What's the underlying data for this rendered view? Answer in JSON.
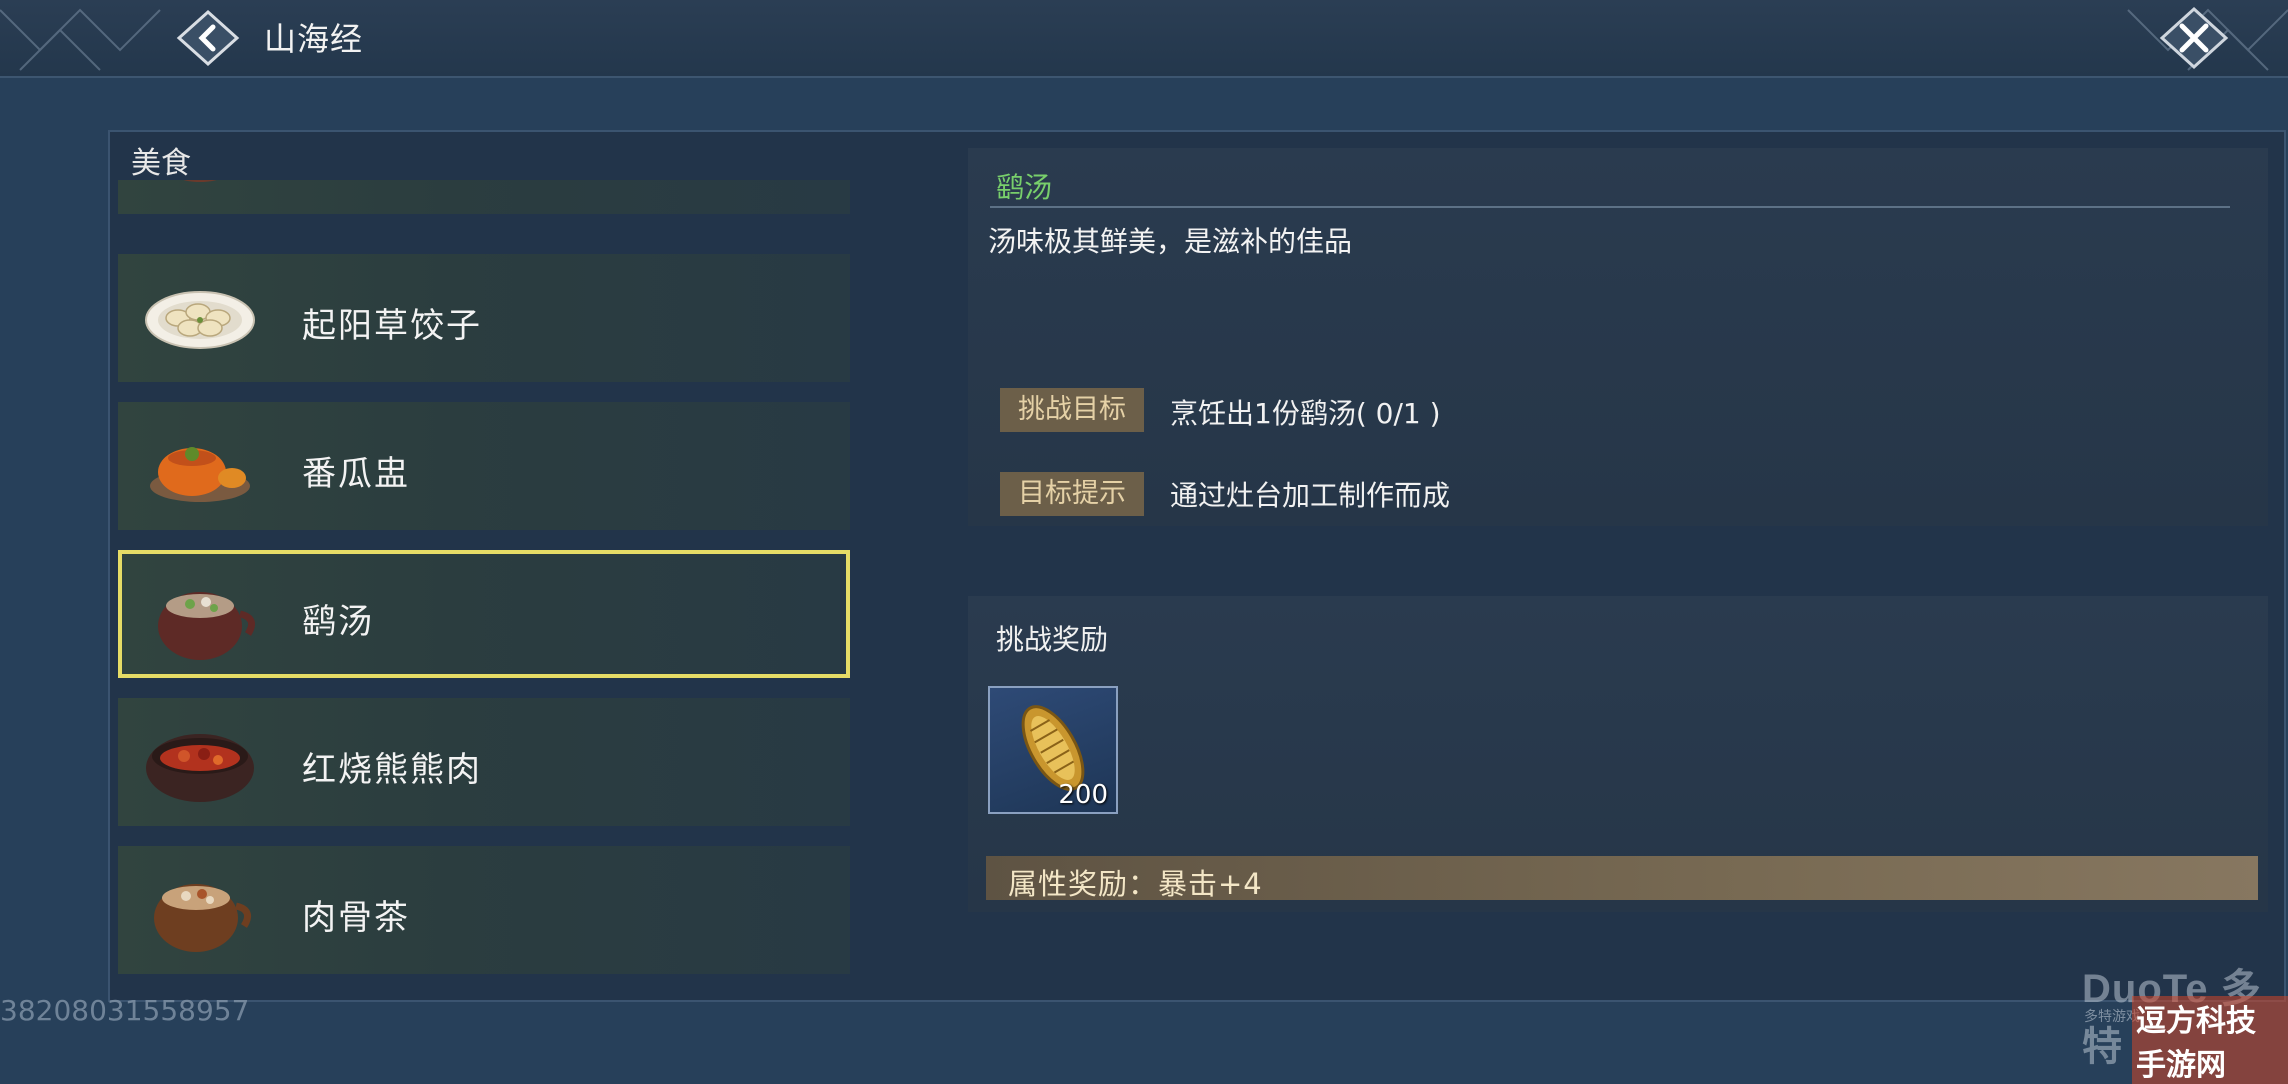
{
  "header": {
    "title": "山海经",
    "back_icon": "back-chevron-icon",
    "close_icon": "close-x-icon"
  },
  "section": {
    "label": "美食"
  },
  "foods": [
    {
      "name": "",
      "icon": "stew-bowl-icon"
    },
    {
      "name": "起阳草饺子",
      "icon": "dumplings-plate-icon"
    },
    {
      "name": "番瓜盅",
      "icon": "pumpkin-cup-icon"
    },
    {
      "name": "鹞汤",
      "icon": "soup-pot-icon",
      "selected": true
    },
    {
      "name": "红烧熊熊肉",
      "icon": "braised-meat-bowl-icon"
    },
    {
      "name": "肉骨茶",
      "icon": "bone-tea-pot-icon"
    }
  ],
  "detail": {
    "title": "鹞汤",
    "description": "汤味极其鲜美，是滋补的佳品",
    "challenge_tag": "挑战目标",
    "challenge_text": "烹饪出1份鹞汤( 0/1 )",
    "hint_tag": "目标提示",
    "hint_text": "通过灶台加工制作而成"
  },
  "reward": {
    "title": "挑战奖励",
    "item_icon": "gold-ingot-icon",
    "item_count": "200",
    "attribute": "属性奖励：暴击+4"
  },
  "watermark": {
    "uid": "38208031558957",
    "logo": "DuoTe 多特",
    "logo_sub": "多特游戏",
    "site": "逗方科技手游网"
  },
  "colors": {
    "selected_border": "#e6dc66",
    "title_green": "#78cf6b",
    "tag_bg": "#6c5f49"
  }
}
